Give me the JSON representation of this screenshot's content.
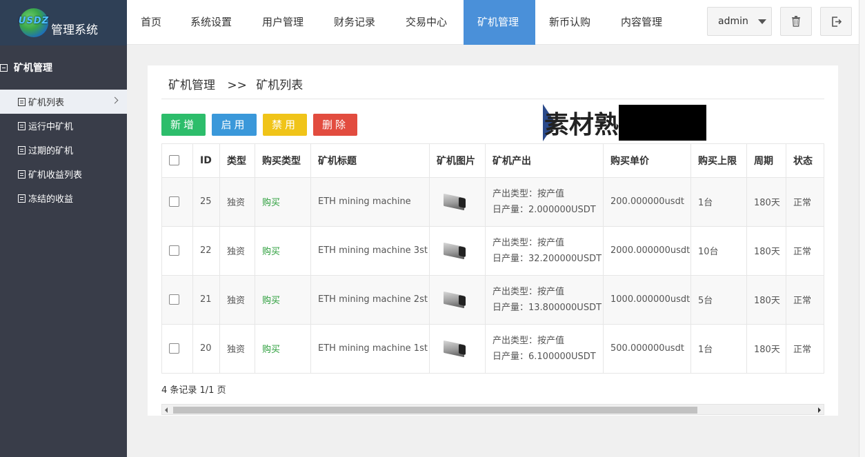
{
  "logo": {
    "badge": "USDZ",
    "title": "管理系统"
  },
  "sidebar": {
    "group": "矿机管理",
    "items": [
      {
        "label": "矿机列表",
        "active": true
      },
      {
        "label": "运行中矿机"
      },
      {
        "label": "过期的矿机"
      },
      {
        "label": "矿机收益列表"
      },
      {
        "label": "冻结的收益"
      }
    ]
  },
  "nav": {
    "items": [
      "首页",
      "系统设置",
      "用户管理",
      "财务记录",
      "交易中心",
      "矿机管理",
      "新币认购",
      "内容管理"
    ],
    "active": "矿机管理",
    "active_color": "#4a90d9",
    "user": "admin"
  },
  "breadcrumb": {
    "section": "矿机管理",
    "sep": ">>",
    "page": "矿机列表"
  },
  "toolbar": {
    "add": "新增",
    "enable": "启用",
    "disable": "禁用",
    "delete": "删除",
    "colors": {
      "add": "#2dbd6b",
      "enable": "#3a98da",
      "disable": "#f0c419",
      "delete": "#e24c3f"
    }
  },
  "watermark": "素材熟",
  "table": {
    "headers": [
      "ID",
      "类型",
      "购买类型",
      "矿机标题",
      "矿机图片",
      "矿机产出",
      "购买单价",
      "购买上限",
      "周期",
      "状态"
    ],
    "rows": [
      {
        "id": "25",
        "type": "独资",
        "buy_type": "购买",
        "title": "ETH mining machine",
        "output_type": "产出类型：按产值",
        "daily": "日产量：2.000000USDT",
        "price": "200.000000usdt",
        "limit": "1台",
        "cycle": "180天",
        "status": "正常"
      },
      {
        "id": "22",
        "type": "独资",
        "buy_type": "购买",
        "title": "ETH mining machine 3st",
        "output_type": "产出类型：按产值",
        "daily": "日产量：32.200000USDT",
        "price": "2000.000000usdt",
        "limit": "10台",
        "cycle": "180天",
        "status": "正常"
      },
      {
        "id": "21",
        "type": "独资",
        "buy_type": "购买",
        "title": "ETH mining machine 2st",
        "output_type": "产出类型：按产值",
        "daily": "日产量：13.800000USDT",
        "price": "1000.000000usdt",
        "limit": "5台",
        "cycle": "180天",
        "status": "正常"
      },
      {
        "id": "20",
        "type": "独资",
        "buy_type": "购买",
        "title": "ETH mining machine 1st",
        "output_type": "产出类型：按产值",
        "daily": "日产量：6.100000USDT",
        "price": "500.000000usdt",
        "limit": "1台",
        "cycle": "180天",
        "status": "正常"
      }
    ]
  },
  "summary": "4 条记录 1/1 页"
}
